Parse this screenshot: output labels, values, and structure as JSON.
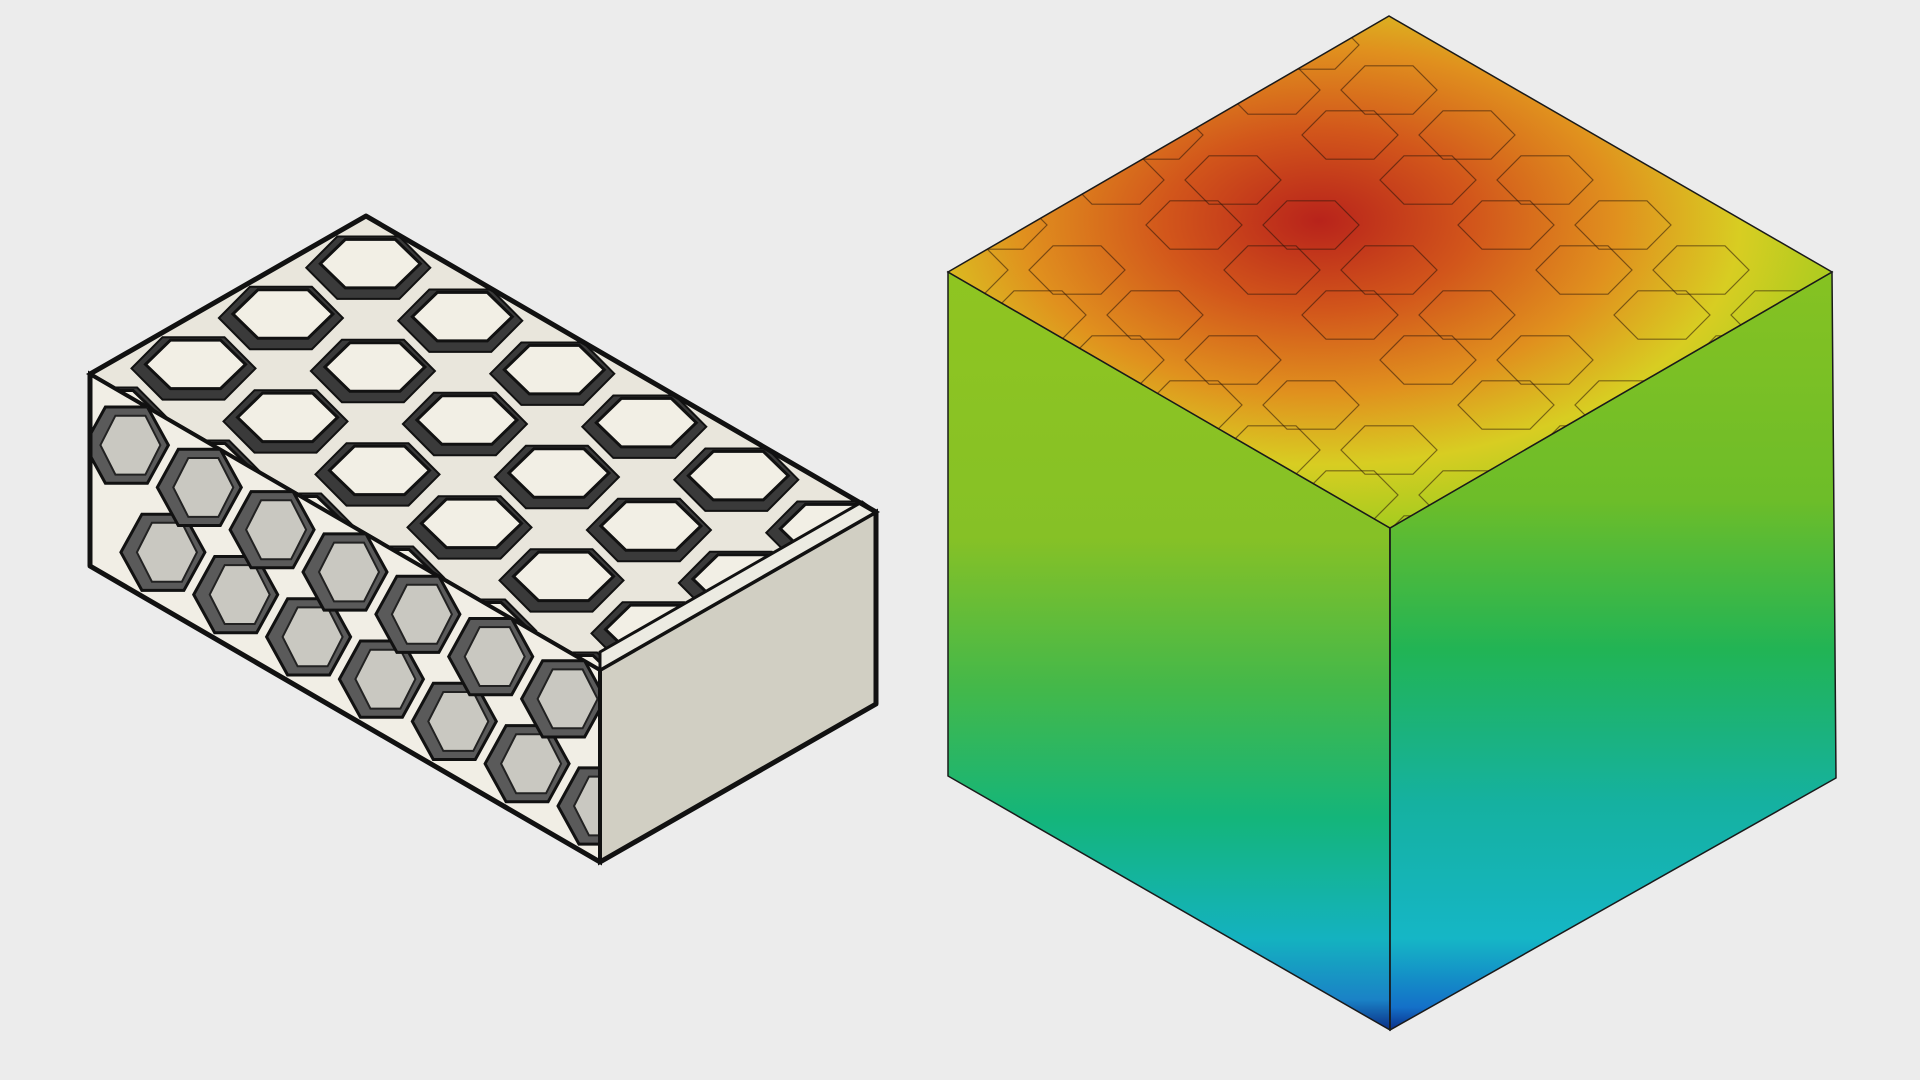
{
  "scene": {
    "background": "#ececec",
    "models": [
      {
        "name": "honeycomb-infill-part",
        "render_style": "cad-shaded-with-edges",
        "colors": {
          "surface": "#f2efe6",
          "side": "#d2d0c3",
          "shadow": "#4a4a4a",
          "edge": "#1a1a1a"
        },
        "infill_pattern": "hexagonal"
      },
      {
        "name": "thermal-simulation-cube",
        "render_style": "simulation-contour",
        "colormap": [
          "#b8231b",
          "#e0801d",
          "#d8d022",
          "#7cc02a",
          "#1bb25a",
          "#12b8c0",
          "#1470c8",
          "#0a2f8a"
        ],
        "infill_pattern": "hexagonal"
      }
    ]
  }
}
